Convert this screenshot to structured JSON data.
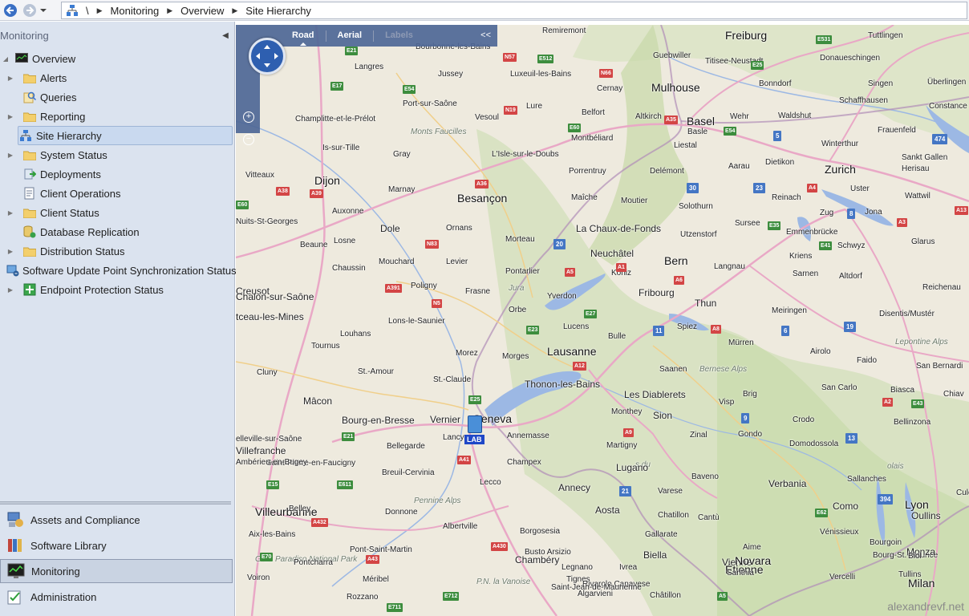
{
  "breadcrumb": {
    "root": "\\",
    "items": [
      "Monitoring",
      "Overview",
      "Site Hierarchy"
    ]
  },
  "nav": {
    "header": "Monitoring",
    "tree": [
      {
        "label": "Overview",
        "icon": "monitor-icon",
        "expand": "▲",
        "level": 0
      },
      {
        "label": "Alerts",
        "icon": "folder-icon",
        "expand": "▶",
        "level": 1
      },
      {
        "label": "Queries",
        "icon": "query-icon",
        "expand": "",
        "level": 1
      },
      {
        "label": "Reporting",
        "icon": "folder-icon",
        "expand": "▶",
        "level": 1
      },
      {
        "label": "Site Hierarchy",
        "icon": "site-hierarchy-icon",
        "expand": "",
        "level": 1,
        "selected": true
      },
      {
        "label": "System Status",
        "icon": "folder-icon",
        "expand": "▶",
        "level": 1
      },
      {
        "label": "Deployments",
        "icon": "deployments-icon",
        "expand": "",
        "level": 1
      },
      {
        "label": "Client Operations",
        "icon": "client-operations-icon",
        "expand": "",
        "level": 1
      },
      {
        "label": "Client Status",
        "icon": "folder-icon",
        "expand": "▶",
        "level": 1
      },
      {
        "label": "Database Replication",
        "icon": "database-replication-icon",
        "expand": "",
        "level": 1
      },
      {
        "label": "Distribution Status",
        "icon": "folder-icon",
        "expand": "▶",
        "level": 1
      },
      {
        "label": "Software Update Point Synchronization Status",
        "icon": "sync-status-icon",
        "expand": "",
        "level": 1
      },
      {
        "label": "Endpoint Protection Status",
        "icon": "endpoint-protection-icon",
        "expand": "▶",
        "level": 1
      }
    ],
    "workspaces": [
      {
        "label": "Assets and Compliance",
        "icon": "assets-compliance-icon"
      },
      {
        "label": "Software Library",
        "icon": "software-library-icon"
      },
      {
        "label": "Monitoring",
        "icon": "monitoring-icon",
        "selected": true
      },
      {
        "label": "Administration",
        "icon": "administration-icon"
      }
    ]
  },
  "map": {
    "tabs": {
      "road": "Road",
      "aerial": "Aerial",
      "labels": "Labels"
    },
    "collapse": "<<",
    "zoom_in": "+",
    "zoom_out": "−",
    "marker_label": "LAB",
    "watermark": "alexandrevf.net",
    "colors": {
      "water": "#9cb8e4",
      "land": "#eeeade",
      "green": "#c9dcae",
      "controls": "#4e6796",
      "marker_label": "#1f47c7"
    },
    "places": [
      {
        "t": "Freiburg",
        "c": "city"
      },
      {
        "t": "Remiremont",
        "c": ""
      },
      {
        "t": "Tuttlingen",
        "c": ""
      },
      {
        "t": "Donaueschingen",
        "c": ""
      },
      {
        "t": "Bourbonne-les-Bains",
        "c": ""
      },
      {
        "t": "Guebwiller",
        "c": ""
      },
      {
        "t": "Titisee-Neustadt",
        "c": ""
      },
      {
        "t": "Langres",
        "c": ""
      },
      {
        "t": "Jussey",
        "c": ""
      },
      {
        "t": "Luxeuil-les-Bains",
        "c": ""
      },
      {
        "t": "Mulhouse",
        "c": "city"
      },
      {
        "t": "Bonndorf",
        "c": ""
      },
      {
        "t": "Singen",
        "c": ""
      },
      {
        "t": "Überlingen",
        "c": ""
      },
      {
        "t": "Cernay",
        "c": ""
      },
      {
        "t": "Schaffhausen",
        "c": ""
      },
      {
        "t": "Constance",
        "c": ""
      },
      {
        "t": "Port-sur-Saône",
        "c": ""
      },
      {
        "t": "Lure",
        "c": ""
      },
      {
        "t": "Belfort",
        "c": ""
      },
      {
        "t": "Altkirch",
        "c": ""
      },
      {
        "t": "Basel",
        "c": "city"
      },
      {
        "t": "Wehr",
        "c": ""
      },
      {
        "t": "Waldshut",
        "c": ""
      },
      {
        "t": "Champlitte-et-le-Prélot",
        "c": ""
      },
      {
        "t": "Vesoul",
        "c": ""
      },
      {
        "t": "Monts Faucilles",
        "c": "area"
      },
      {
        "t": "Basle",
        "c": ""
      },
      {
        "t": "Frauenfeld",
        "c": ""
      },
      {
        "t": "Montbéliard",
        "c": ""
      },
      {
        "t": "Liestal",
        "c": ""
      },
      {
        "t": "Winterthur",
        "c": ""
      },
      {
        "t": "Is-sur-Tille",
        "c": ""
      },
      {
        "t": "Gray",
        "c": ""
      },
      {
        "t": "L'Isle-sur-le-Doubs",
        "c": ""
      },
      {
        "t": "Sankt Gallen",
        "c": ""
      },
      {
        "t": "Herisau",
        "c": ""
      },
      {
        "t": "Aarau",
        "c": ""
      },
      {
        "t": "Dietikon",
        "c": ""
      },
      {
        "t": "Zurich",
        "c": "city"
      },
      {
        "t": "Porrentruy",
        "c": ""
      },
      {
        "t": "Delémont",
        "c": ""
      },
      {
        "t": "Vitteaux",
        "c": ""
      },
      {
        "t": "Dijon",
        "c": "city"
      },
      {
        "t": "Uster",
        "c": ""
      },
      {
        "t": "Marnay",
        "c": ""
      },
      {
        "t": "Besançon",
        "c": "city"
      },
      {
        "t": "Maîche",
        "c": ""
      },
      {
        "t": "Moutier",
        "c": ""
      },
      {
        "t": "Reinach",
        "c": ""
      },
      {
        "t": "Wattwil",
        "c": ""
      },
      {
        "t": "Solothurn",
        "c": ""
      },
      {
        "t": "Auxonne",
        "c": ""
      },
      {
        "t": "Zug",
        "c": ""
      },
      {
        "t": "Jona",
        "c": ""
      },
      {
        "t": "Nuits-St-Georges",
        "c": ""
      },
      {
        "t": "Sursee",
        "c": ""
      },
      {
        "t": "Dole",
        "c": "mid"
      },
      {
        "t": "Ornans",
        "c": ""
      },
      {
        "t": "La Chaux-de-Fonds",
        "c": "mid"
      },
      {
        "t": "Emmenbrücke",
        "c": ""
      },
      {
        "t": "Utzenstorf",
        "c": ""
      },
      {
        "t": "Glarus",
        "c": ""
      },
      {
        "t": "Beaune",
        "c": ""
      },
      {
        "t": "Losne",
        "c": ""
      },
      {
        "t": "Morteau",
        "c": ""
      },
      {
        "t": "Kriens",
        "c": ""
      },
      {
        "t": "Schwyz",
        "c": ""
      },
      {
        "t": "Neuchâtel",
        "c": "mid"
      },
      {
        "t": "Bern",
        "c": "city"
      },
      {
        "t": "Mouchard",
        "c": ""
      },
      {
        "t": "Levier",
        "c": ""
      },
      {
        "t": "Langnau",
        "c": ""
      },
      {
        "t": "Chaussin",
        "c": ""
      },
      {
        "t": "Pontarlier",
        "c": ""
      },
      {
        "t": "Köniz",
        "c": ""
      },
      {
        "t": "Sarnen",
        "c": ""
      },
      {
        "t": "Altdorf",
        "c": ""
      },
      {
        "t": "Poligny",
        "c": ""
      },
      {
        "t": "Jura",
        "c": "area"
      },
      {
        "t": "Fribourg",
        "c": "mid"
      },
      {
        "t": "Reichenau",
        "c": ""
      },
      {
        "t": "Creusot",
        "c": "mid"
      },
      {
        "t": "Frasne",
        "c": ""
      },
      {
        "t": "Chalon-sur-Saône",
        "c": "mid"
      },
      {
        "t": "Yverdon",
        "c": ""
      },
      {
        "t": "Thun",
        "c": "mid"
      },
      {
        "t": "Meiringen",
        "c": ""
      },
      {
        "t": "Orbe",
        "c": ""
      },
      {
        "t": "Disentis/Mustér",
        "c": ""
      },
      {
        "t": "tceau-les-Mines",
        "c": "mid"
      },
      {
        "t": "Lons-le-Saunier",
        "c": ""
      },
      {
        "t": "Lucens",
        "c": ""
      },
      {
        "t": "Spiez",
        "c": ""
      },
      {
        "t": "Louhans",
        "c": ""
      },
      {
        "t": "Bulle",
        "c": ""
      },
      {
        "t": "Mürren",
        "c": ""
      },
      {
        "t": "Lepontine Alps",
        "c": "area"
      },
      {
        "t": "Tournus",
        "c": ""
      },
      {
        "t": "Morez",
        "c": ""
      },
      {
        "t": "Lausanne",
        "c": "city"
      },
      {
        "t": "Airolo",
        "c": ""
      },
      {
        "t": "Morges",
        "c": ""
      },
      {
        "t": "Faido",
        "c": ""
      },
      {
        "t": "Bernese Alps",
        "c": "area"
      },
      {
        "t": "Cluny",
        "c": ""
      },
      {
        "t": "St.-Amour",
        "c": ""
      },
      {
        "t": "Saanen",
        "c": ""
      },
      {
        "t": "San Bernardi",
        "c": ""
      },
      {
        "t": "St.-Claude",
        "c": ""
      },
      {
        "t": "Thonon-les-Bains",
        "c": "mid"
      },
      {
        "t": "Les Diablerets",
        "c": "mid"
      },
      {
        "t": "San Carlo",
        "c": ""
      },
      {
        "t": "Biasca",
        "c": ""
      },
      {
        "t": "Mâcon",
        "c": "mid"
      },
      {
        "t": "Brig",
        "c": ""
      },
      {
        "t": "Visp",
        "c": ""
      },
      {
        "t": "Chiav",
        "c": ""
      },
      {
        "t": "Bourg-en-Bresse",
        "c": "mid"
      },
      {
        "t": "Vernier",
        "c": "mid"
      },
      {
        "t": "Geneva",
        "c": "city"
      },
      {
        "t": "Monthey",
        "c": ""
      },
      {
        "t": "Sion",
        "c": "mid"
      },
      {
        "t": "Crodo",
        "c": ""
      },
      {
        "t": "Bellinzona",
        "c": ""
      },
      {
        "t": "Lancy",
        "c": ""
      },
      {
        "t": "Annemasse",
        "c": ""
      },
      {
        "t": "Zinal",
        "c": ""
      },
      {
        "t": "Gondo",
        "c": ""
      },
      {
        "t": "elleville-sur-Saône",
        "c": ""
      },
      {
        "t": "Bellegarde",
        "c": ""
      },
      {
        "t": "Martigny",
        "c": ""
      },
      {
        "t": "Domodossola",
        "c": ""
      },
      {
        "t": "s du",
        "c": "area"
      },
      {
        "t": "Villefranche",
        "c": "mid"
      },
      {
        "t": "Saint-Pierre-en-Faucigny",
        "c": ""
      },
      {
        "t": "Champex",
        "c": ""
      },
      {
        "t": "Lugano",
        "c": "mid"
      },
      {
        "t": "olais",
        "c": "area"
      },
      {
        "t": "Ambérieu-en-Bugey",
        "c": ""
      },
      {
        "t": "Breuil-Cervinia",
        "c": ""
      },
      {
        "t": "Baveno",
        "c": ""
      },
      {
        "t": "Verbania",
        "c": "mid"
      },
      {
        "t": "Sallanches",
        "c": ""
      },
      {
        "t": "Annecy",
        "c": "mid"
      },
      {
        "t": "Lecco",
        "c": ""
      },
      {
        "t": "Culoz",
        "c": ""
      },
      {
        "t": "Pennine Alps",
        "c": "area"
      },
      {
        "t": "Varese",
        "c": ""
      },
      {
        "t": "Como",
        "c": "mid"
      },
      {
        "t": "Lyon",
        "c": "city"
      },
      {
        "t": "Villeurbanne",
        "c": "city"
      },
      {
        "t": "Belley",
        "c": ""
      },
      {
        "t": "Donnone",
        "c": ""
      },
      {
        "t": "Aosta",
        "c": "mid"
      },
      {
        "t": "Chatillon",
        "c": ""
      },
      {
        "t": "Cantù",
        "c": ""
      },
      {
        "t": "Oullins",
        "c": "mid"
      },
      {
        "t": "Aix-les-Bains",
        "c": ""
      },
      {
        "t": "Albertville",
        "c": ""
      },
      {
        "t": "Borgosesia",
        "c": ""
      },
      {
        "t": "Gallarate",
        "c": ""
      },
      {
        "t": "Vénissieux",
        "c": ""
      },
      {
        "t": "Bourgoin",
        "c": ""
      },
      {
        "t": "Pont-Saint-Martin",
        "c": ""
      },
      {
        "t": "Busto Arsizio",
        "c": ""
      },
      {
        "t": "Chambéry",
        "c": "mid"
      },
      {
        "t": "Aime",
        "c": ""
      },
      {
        "t": "Bourg-St.-Maurice",
        "c": ""
      },
      {
        "t": "Biella",
        "c": "mid"
      },
      {
        "t": "Monza",
        "c": "mid"
      },
      {
        "t": "Vienne",
        "c": "mid"
      },
      {
        "t": "Gran Paradiso National Park",
        "c": "area"
      },
      {
        "t": "Legnano",
        "c": ""
      },
      {
        "t": "Étienne",
        "c": "city"
      },
      {
        "t": "Biol",
        "c": ""
      },
      {
        "t": "Pontcharra",
        "c": ""
      },
      {
        "t": "Tignes",
        "c": ""
      },
      {
        "t": "Ivrea",
        "c": ""
      },
      {
        "t": "Novara",
        "c": "city"
      },
      {
        "t": "Milan",
        "c": "city"
      },
      {
        "t": "Voiron",
        "c": ""
      },
      {
        "t": "Méribel",
        "c": ""
      },
      {
        "t": "P.N. la Vanoise",
        "c": "area"
      },
      {
        "t": "Rivarolo Canavese",
        "c": ""
      },
      {
        "t": "Santhià",
        "c": ""
      },
      {
        "t": "Vercelli",
        "c": ""
      },
      {
        "t": "Tullins",
        "c": ""
      },
      {
        "t": "Rozzano",
        "c": ""
      },
      {
        "t": "Saint-Jean-de-Maurienne",
        "c": ""
      },
      {
        "t": "Algarvieni",
        "c": ""
      },
      {
        "t": "Châtillon",
        "c": ""
      }
    ],
    "shields": [
      {
        "t": "E21",
        "c": "green"
      },
      {
        "t": "N57",
        "c": "red"
      },
      {
        "t": "E512",
        "c": "green"
      },
      {
        "t": "E531",
        "c": "green"
      },
      {
        "t": "E17",
        "c": "green"
      },
      {
        "t": "E54",
        "c": "green"
      },
      {
        "t": "N66",
        "c": "red"
      },
      {
        "t": "E25",
        "c": "green"
      },
      {
        "t": "N19",
        "c": "red"
      },
      {
        "t": "E60",
        "c": "green"
      },
      {
        "t": "A35",
        "c": "red"
      },
      {
        "t": "E54",
        "c": "green"
      },
      {
        "t": "5",
        "c": "blue"
      },
      {
        "t": "474",
        "c": "blue"
      },
      {
        "t": "A36",
        "c": "red"
      },
      {
        "t": "30",
        "c": "blue"
      },
      {
        "t": "23",
        "c": "blue"
      },
      {
        "t": "A4",
        "c": "red"
      },
      {
        "t": "A38",
        "c": "red"
      },
      {
        "t": "A39",
        "c": "red"
      },
      {
        "t": "E60",
        "c": "green"
      },
      {
        "t": "8",
        "c": "blue"
      },
      {
        "t": "A3",
        "c": "red"
      },
      {
        "t": "A13",
        "c": "red"
      },
      {
        "t": "E35",
        "c": "green"
      },
      {
        "t": "N83",
        "c": "red"
      },
      {
        "t": "20",
        "c": "blue"
      },
      {
        "t": "E41",
        "c": "green"
      },
      {
        "t": "A1",
        "c": "red"
      },
      {
        "t": "A5",
        "c": "red"
      },
      {
        "t": "A6",
        "c": "red"
      },
      {
        "t": "A391",
        "c": "red"
      },
      {
        "t": "N5",
        "c": "red"
      },
      {
        "t": "E27",
        "c": "green"
      },
      {
        "t": "E23",
        "c": "green"
      },
      {
        "t": "11",
        "c": "blue"
      },
      {
        "t": "A8",
        "c": "red"
      },
      {
        "t": "6",
        "c": "blue"
      },
      {
        "t": "19",
        "c": "blue"
      },
      {
        "t": "A12",
        "c": "red"
      },
      {
        "t": "E25",
        "c": "green"
      },
      {
        "t": "A2",
        "c": "red"
      },
      {
        "t": "E43",
        "c": "green"
      },
      {
        "t": "9",
        "c": "blue"
      },
      {
        "t": "E21",
        "c": "green"
      },
      {
        "t": "A9",
        "c": "red"
      },
      {
        "t": "13",
        "c": "blue"
      },
      {
        "t": "A41",
        "c": "red"
      },
      {
        "t": "E15",
        "c": "green"
      },
      {
        "t": "E611",
        "c": "green"
      },
      {
        "t": "21",
        "c": "blue"
      },
      {
        "t": "394",
        "c": "blue"
      },
      {
        "t": "A432",
        "c": "red"
      },
      {
        "t": "E62",
        "c": "green"
      },
      {
        "t": "A430",
        "c": "red"
      },
      {
        "t": "E70",
        "c": "green"
      },
      {
        "t": "A43",
        "c": "red"
      },
      {
        "t": "E712",
        "c": "green"
      },
      {
        "t": "A5",
        "c": "green"
      },
      {
        "t": "E711",
        "c": "green"
      }
    ]
  }
}
